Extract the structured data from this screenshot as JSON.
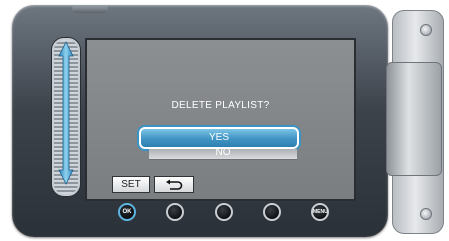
{
  "dialog": {
    "question": "DELETE PLAYLIST?",
    "yes_label": "YES",
    "no_label": "NO"
  },
  "lcd_buttons": {
    "set_label": "SET",
    "back_icon": "return-arrow-icon"
  },
  "hardware_buttons": {
    "ok_label": "OK",
    "menu_label": "MENU"
  },
  "colors": {
    "selected": "#3f94c4",
    "highlight_ring": "#5fb5e0",
    "lcd_background": "#828588"
  }
}
